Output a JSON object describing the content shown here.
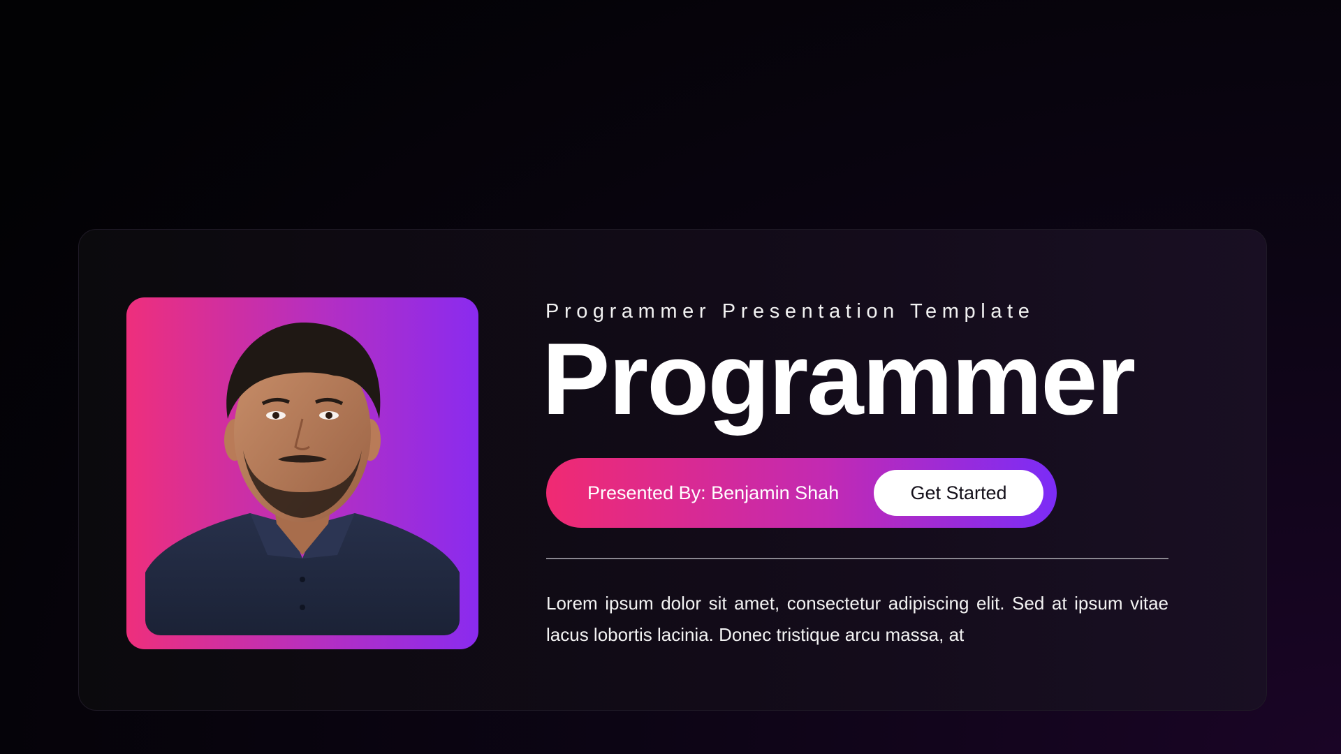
{
  "slide": {
    "subtitle": "Programmer Presentation Template",
    "headline": "Programmer",
    "presenter_label": "Presented By: Benjamin Shah",
    "cta_label": "Get Started",
    "body_text": "Lorem ipsum dolor sit amet, consectetur adipiscing elit. Sed at ipsum vitae lacus lobortis lacinia. Donec tristique arcu massa, at"
  },
  "colors": {
    "background": "#05030a",
    "card": "#120b18",
    "gradient_start": "#ef2f78",
    "gradient_end": "#8a2bef",
    "button_bg": "#ffffff",
    "button_text": "#14101a",
    "text": "#ffffff"
  },
  "images": {
    "portrait": "person-portrait-photo"
  }
}
